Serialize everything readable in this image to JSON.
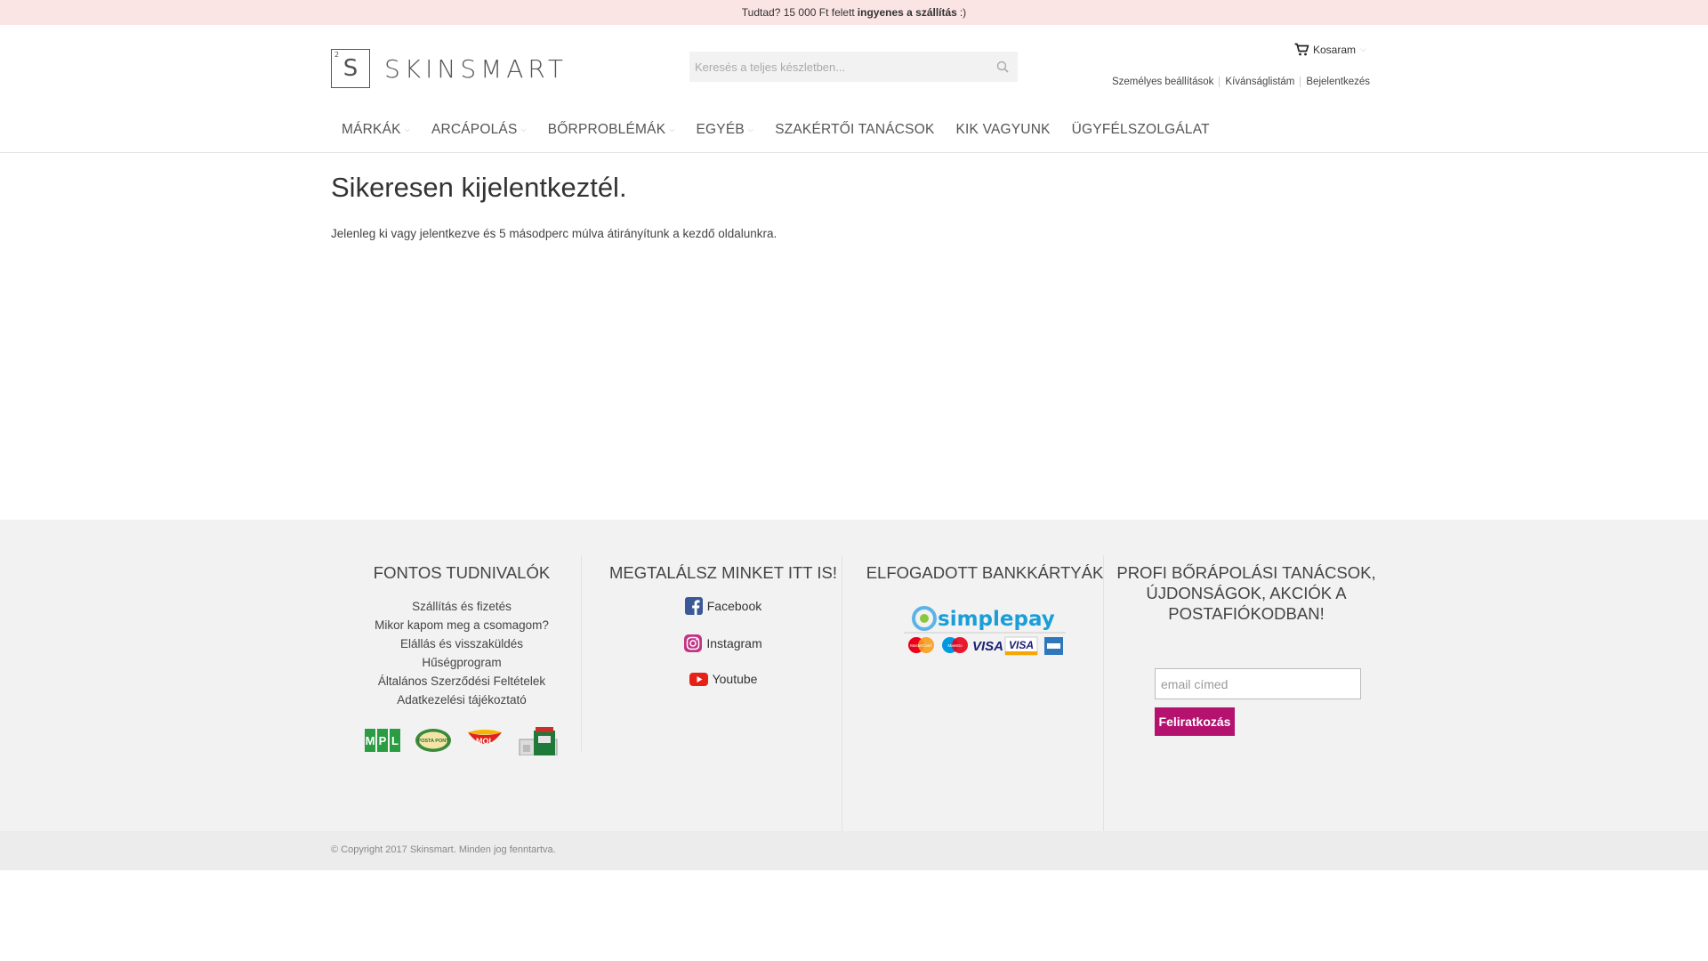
{
  "topbar": {
    "text_before": "Tudtad? 15 000 Ft felett",
    "text_bold": "ingyenes a szállítás",
    "text_after": ":)"
  },
  "logo": {
    "superscript": "2",
    "letter": "S",
    "text": "SKINSMART"
  },
  "search": {
    "placeholder": "Keresés a teljes készletben...",
    "icon": "search-icon"
  },
  "cart": {
    "label": "Kosaram",
    "icon": "cart-icon"
  },
  "toplinks": [
    "Személyes beállítások",
    "Kívánságlistám",
    "Bejelentkezés"
  ],
  "nav": [
    {
      "label": "Márkák",
      "dropdown": true
    },
    {
      "label": "Arcápolás",
      "dropdown": true
    },
    {
      "label": "Bőrproblémák",
      "dropdown": true
    },
    {
      "label": "Egyéb",
      "dropdown": true
    },
    {
      "label": "Szakértői tanácsok",
      "dropdown": false
    },
    {
      "label": "Kik vagyunk",
      "dropdown": false
    },
    {
      "label": "Ügyfélszolgálat",
      "dropdown": false
    }
  ],
  "main": {
    "title": "Sikeresen kijelentkeztél.",
    "text": "Jelenleg ki vagy jelentkezve és 5 másodperc múlva átirányítunk a kezdő oldalunkra."
  },
  "footer": {
    "col1": {
      "heading": "Fontos tudnivalók",
      "links": [
        "Szállítás és fizetés",
        "Mikor kapom meg a csomagom?",
        "Elállás és visszaküldés",
        "Hűségprogram",
        "Általános Szerződési Feltételek",
        "Adatkezelési tájékoztató"
      ],
      "partners": {
        "mpl": "MPL",
        "posta": "POSTA PONT",
        "mol": "MOL"
      }
    },
    "col2": {
      "heading": "Megtalálsz minket itt is!",
      "links": [
        "Facebook",
        "Instagram",
        "Youtube"
      ]
    },
    "col3": {
      "heading": "Elfogadott bankkártyák",
      "logo": "simplepay",
      "cards": {
        "mastercard": "MasterCard",
        "maestro": "Maestro",
        "visa": "VISA",
        "visa2": "VISA"
      }
    },
    "col4": {
      "heading": "Profi bőrápolási tanácsok, újdonságok, akciók a postafiókodban!",
      "email_placeholder": "email címed",
      "button": "Feliratkozás"
    }
  },
  "copyright": "© Copyright 2017 Skinsmart. Minden jog fenntartva.",
  "colors": {
    "topbar_bg": "#fbe4e4",
    "accent": "#b5126f",
    "footer_bg": "#f2f2f2"
  }
}
